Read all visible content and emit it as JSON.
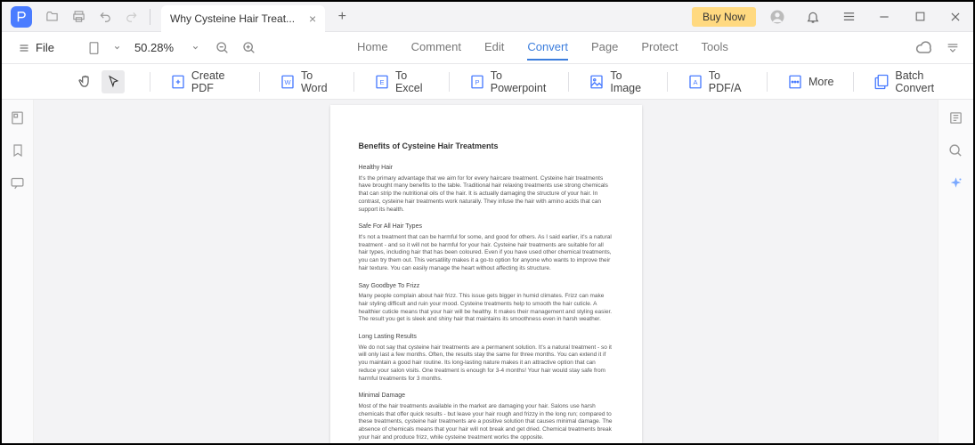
{
  "titlebar": {
    "tab_title": "Why Cysteine Hair Treat...",
    "buy_now": "Buy Now"
  },
  "menubar": {
    "file": "File",
    "zoom": "50.28%",
    "items": [
      "Home",
      "Comment",
      "Edit",
      "Convert",
      "Page",
      "Protect",
      "Tools"
    ],
    "active_index": 3
  },
  "toolbar": {
    "create_pdf": "Create PDF",
    "to_word": "To Word",
    "to_excel": "To Excel",
    "to_powerpoint": "To Powerpoint",
    "to_image": "To Image",
    "to_pdfa": "To PDF/A",
    "more": "More",
    "batch_convert": "Batch Convert"
  },
  "document": {
    "title": "Benefits of Cysteine Hair Treatments",
    "sections": [
      {
        "heading": "Healthy Hair",
        "body": "It's the primary advantage that we aim for for every haircare treatment. Cysteine hair treatments have brought many benefits to the table. Traditional hair relaxing treatments use strong chemicals that can strip the nutritional oils of the hair. It is actually damaging the structure of your hair. In contrast, cysteine hair treatments work naturally. They infuse the hair with amino acids that can support its health."
      },
      {
        "heading": "Safe For All Hair Types",
        "body": "It's not a treatment that can be harmful for some, and good for others. As I said earlier, it's a natural treatment - and so it will not be harmful for your hair. Cysteine hair treatments are suitable for all hair types, including hair that has been coloured. Even if you have used other chemical treatments, you can try them out. This versatility makes it a go-to option for anyone who wants to improve their hair texture. You can easily manage the heart without affecting its structure."
      },
      {
        "heading": "Say Goodbye To Frizz",
        "body": "Many people complain about hair frizz. This issue gets bigger in humid climates. Frizz can make hair styling difficult and ruin your mood. Cysteine treatments help to smooth the hair cuticle. A healthier cuticle means that your hair will be healthy. It makes their management and styling easier. The result you get is sleek and shiny hair that maintains its smoothness even in harsh weather."
      },
      {
        "heading": "Long Lasting Results",
        "body": "We do not say that cysteine hair treatments are a permanent solution. It's a natural treatment - so it will only last a few months. Often, the results stay the same for three months. You can extend it if you maintain a good hair routine. Its long-lasting nature makes it an attractive option that can reduce your salon visits. One treatment is enough for 3-4 months! Your hair would stay safe from harmful treatments for 3 months."
      },
      {
        "heading": "Minimal Damage",
        "body": "Most of the hair treatments available in the market are damaging your hair. Salons use harsh chemicals that offer quick results - but leave your hair rough and frizzy in the long run; compared to these treatments, cysteine hair treatments are a positive solution that causes minimal damage. The absence of chemicals means that your hair will not break and get dried. Chemical treatments break your hair and produce frizz, while cysteine treatment works the opposite."
      }
    ]
  }
}
